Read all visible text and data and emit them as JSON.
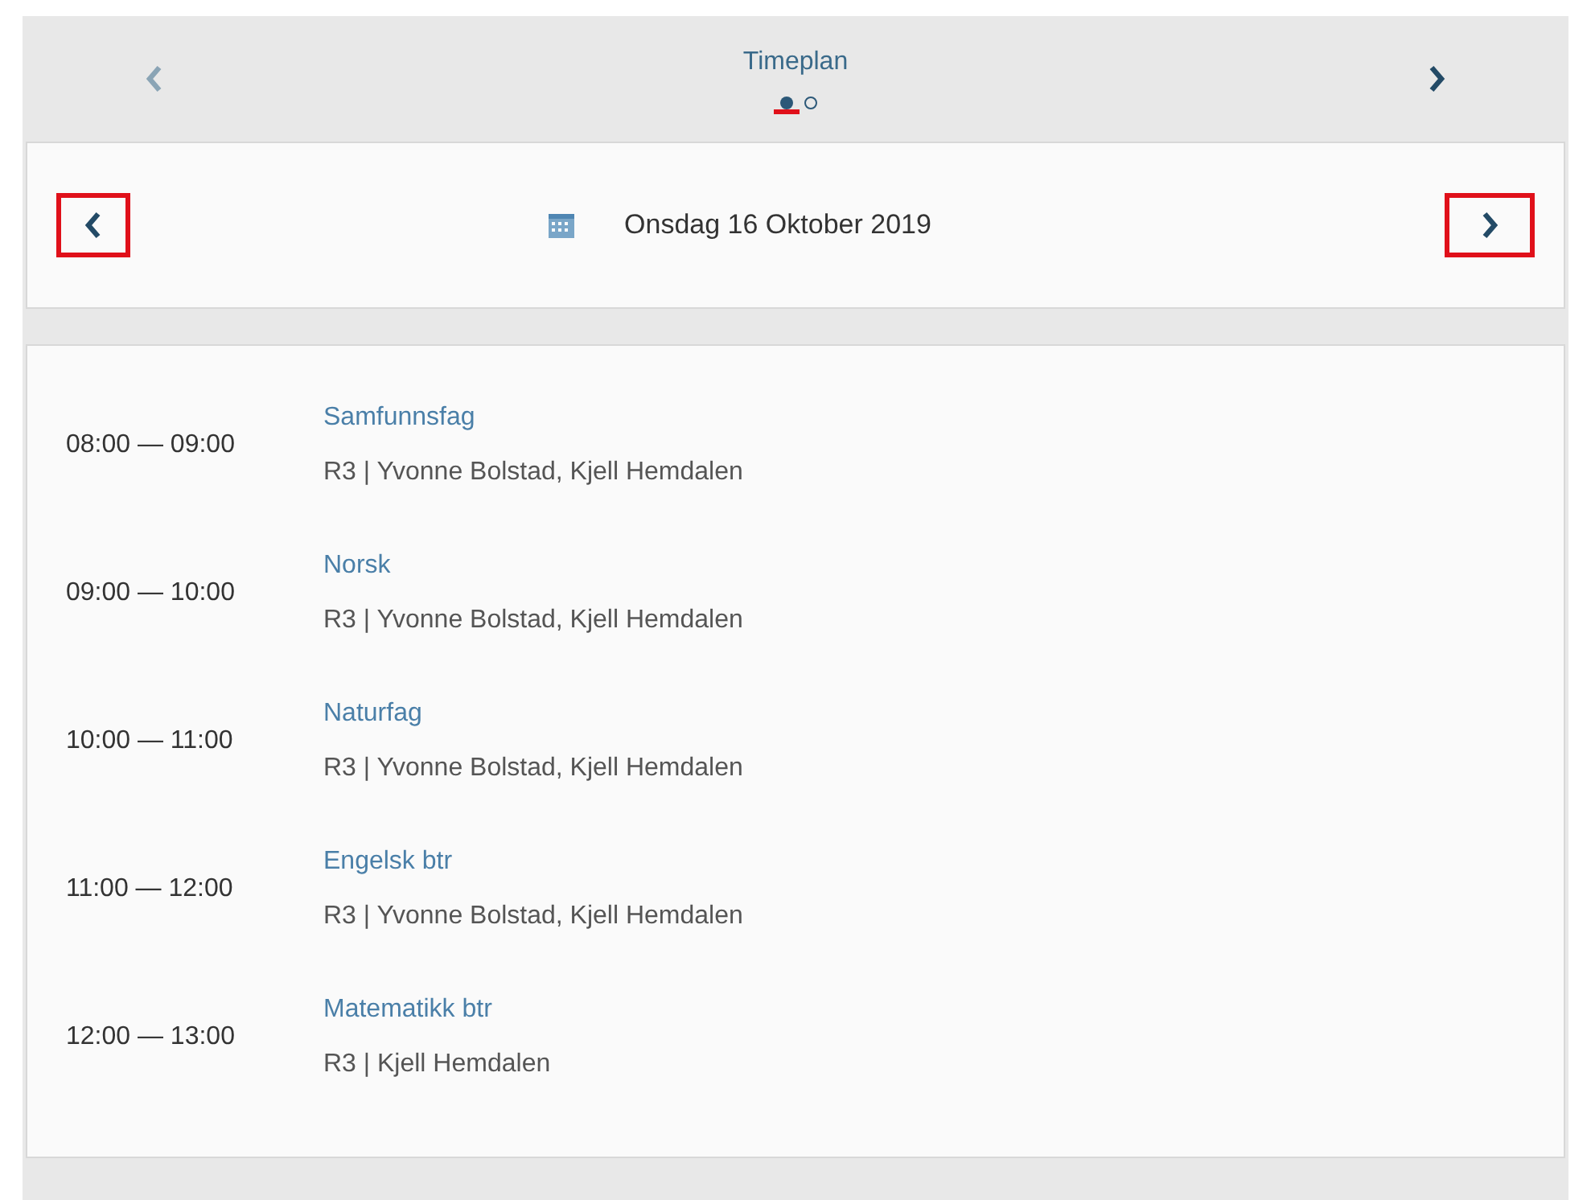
{
  "header": {
    "title": "Timeplan",
    "pages": [
      {
        "selected": true
      },
      {
        "selected": false
      }
    ],
    "prev_enabled": false,
    "next_enabled": true
  },
  "date_bar": {
    "date": "Onsdag 16 Oktober 2019",
    "prev_highlighted": true,
    "next_highlighted": true
  },
  "lessons": [
    {
      "time": "08:00 — 09:00",
      "subject": "Samfunnsfag",
      "details": "R3 | Yvonne Bolstad, Kjell Hemdalen"
    },
    {
      "time": "09:00 — 10:00",
      "subject": "Norsk",
      "details": "R3 | Yvonne Bolstad, Kjell Hemdalen"
    },
    {
      "time": "10:00 — 11:00",
      "subject": "Naturfag",
      "details": "R3 | Yvonne Bolstad, Kjell Hemdalen"
    },
    {
      "time": "11:00 — 12:00",
      "subject": "Engelsk btr",
      "details": "R3 | Yvonne Bolstad, Kjell Hemdalen"
    },
    {
      "time": "12:00 — 13:00",
      "subject": "Matematikk btr",
      "details": "R3 | Kjell Hemdalen"
    }
  ]
}
